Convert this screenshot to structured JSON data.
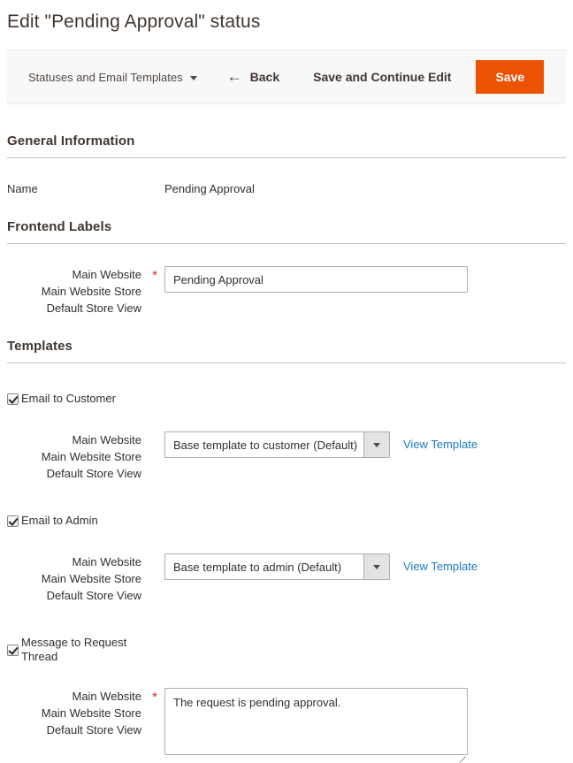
{
  "page": {
    "title": "Edit \"Pending Approval\" status"
  },
  "toolbar": {
    "split_label": "Statuses and Email Templates",
    "back_label": "Back",
    "back_arrow": "←",
    "save_continue_label": "Save and Continue Edit",
    "save_label": "Save",
    "accent_color": "#eb5202"
  },
  "sections": {
    "general": {
      "heading": "General Information",
      "name_label": "Name",
      "name_value": "Pending Approval"
    },
    "frontend": {
      "heading": "Frontend Labels",
      "scope": {
        "website": "Main Website",
        "store": "Main Website Store",
        "store_view": "Default Store View"
      },
      "required_marker": "*",
      "input_value": "Pending Approval",
      "input_placeholder": ""
    },
    "templates": {
      "heading": "Templates",
      "email_customer": {
        "checkbox_label": "Email to Customer",
        "checked": true,
        "scope": {
          "website": "Main Website",
          "store": "Main Website Store",
          "store_view": "Default Store View"
        },
        "select_value": "Base template to customer (Default)",
        "link_label": "View Template",
        "link_color": "#1979c3"
      },
      "email_admin": {
        "checkbox_label": "Email to Admin",
        "checked": true,
        "scope": {
          "website": "Main Website",
          "store": "Main Website Store",
          "store_view": "Default Store View"
        },
        "select_value": "Base template to admin (Default)",
        "link_label": "View Template",
        "link_color": "#1979c3"
      },
      "message_thread": {
        "checkbox_label": "Message to Request Thread",
        "checked": true,
        "scope": {
          "website": "Main Website",
          "store": "Main Website Store",
          "store_view": "Default Store View"
        },
        "required_marker": "*",
        "textarea_value": "The request is pending approval.",
        "textarea_placeholder": ""
      }
    }
  }
}
